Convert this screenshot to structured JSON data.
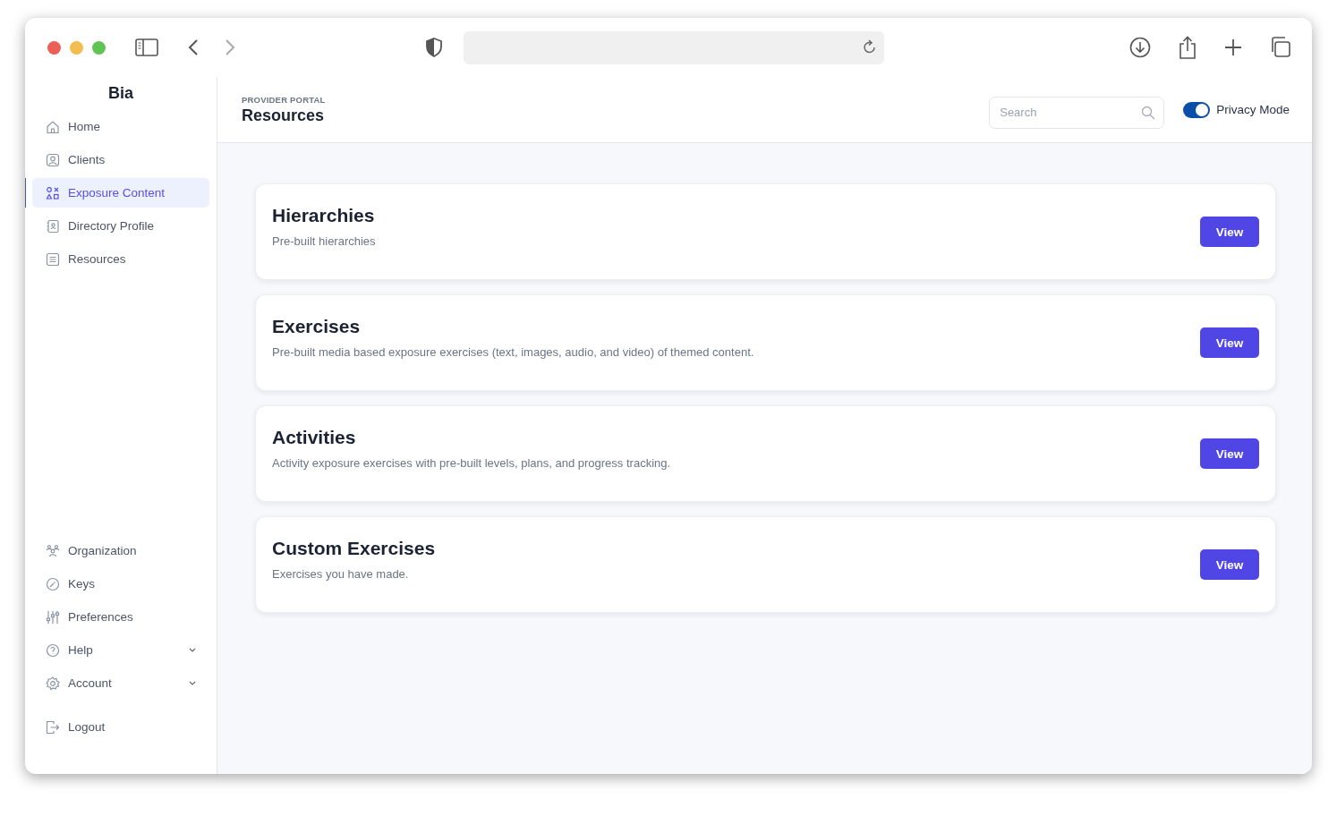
{
  "sidebar": {
    "brand": "Bia",
    "main_items": [
      {
        "label": "Home",
        "selected": false
      },
      {
        "label": "Clients",
        "selected": false
      },
      {
        "label": "Exposure Content",
        "selected": true
      },
      {
        "label": "Directory Profile",
        "selected": false
      },
      {
        "label": "Resources",
        "selected": false
      }
    ],
    "bottom_items": [
      {
        "label": "Organization",
        "kind": "link"
      },
      {
        "label": "Keys",
        "kind": "link"
      },
      {
        "label": "Preferences",
        "kind": "link"
      },
      {
        "label": "Help",
        "kind": "group"
      },
      {
        "label": "Account",
        "kind": "group"
      }
    ],
    "logout": "Logout"
  },
  "header": {
    "eyebrow": "PROVIDER PORTAL",
    "title": "Resources",
    "search": {
      "placeholder": "Search"
    },
    "privacy_toggle": {
      "label": "Privacy Mode",
      "on": true
    }
  },
  "cards": [
    {
      "title": "Hierarchies",
      "description": "Pre-built hierarchies",
      "button": "View"
    },
    {
      "title": "Exercises",
      "description": "Pre-built media based exposure exercises (text, images, audio, and video) of themed content.",
      "button": "View"
    },
    {
      "title": "Activities",
      "description": "Activity exposure exercises with pre-built levels, plans, and progress tracking.",
      "button": "View"
    },
    {
      "title": "Custom Exercises",
      "description": "Exercises you have made.",
      "button": "View"
    }
  ]
}
